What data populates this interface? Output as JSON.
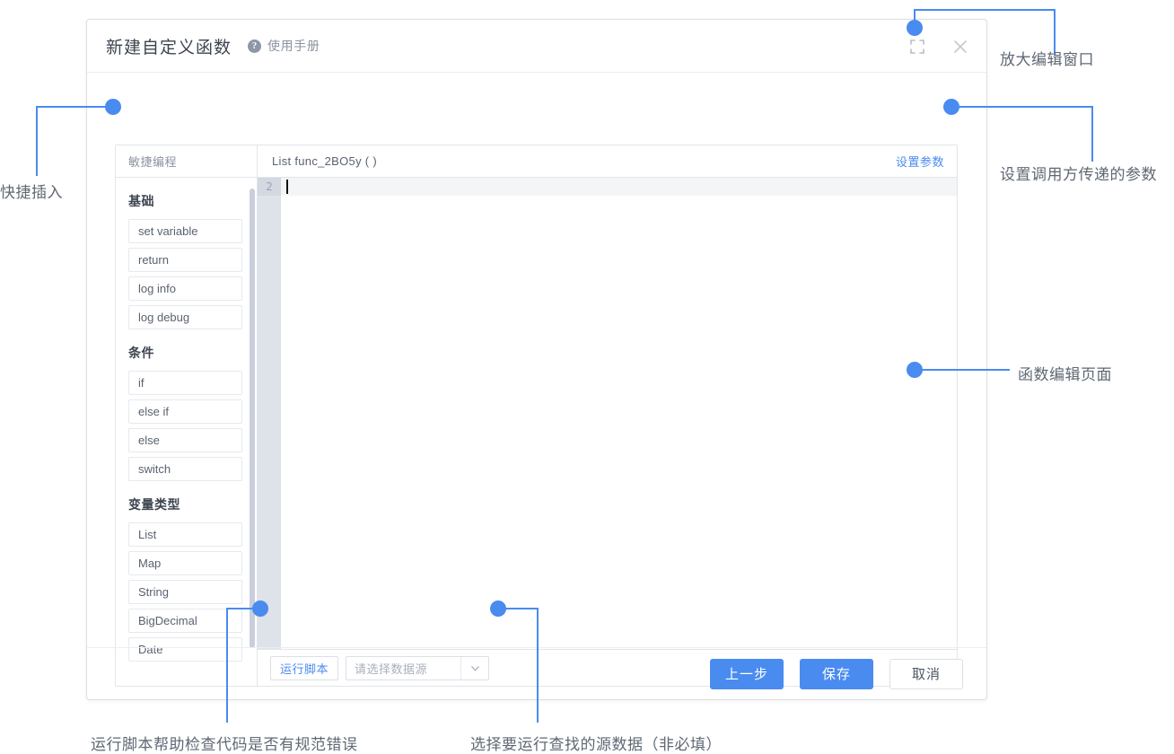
{
  "dialog": {
    "title": "新建自定义函数",
    "manual_label": "使用手册",
    "help_icon": "question-circle-icon",
    "expand_icon": "fullscreen-expand-icon",
    "close_icon": "close-icon"
  },
  "sidebar": {
    "header": "敏捷编程",
    "groups": [
      {
        "title": "基础",
        "items": [
          "set variable",
          "return",
          "log info",
          "log debug"
        ]
      },
      {
        "title": "条件",
        "items": [
          "if",
          "else if",
          "else",
          "switch"
        ]
      },
      {
        "title": "变量类型",
        "items": [
          "List",
          "Map",
          "String",
          "BigDecimal",
          "Date"
        ]
      }
    ]
  },
  "editor": {
    "signature": "List func_2BO5y ( )",
    "param_link": "设置参数",
    "line_number": "2",
    "code": ""
  },
  "runbar": {
    "run_label": "运行脚本",
    "datasource_placeholder": "请选择数据源",
    "datasource_value": "",
    "dropdown_icon": "chevron-down-icon",
    "collapse_icon": "chevron-up-icon"
  },
  "footer": {
    "prev_label": "上一步",
    "save_label": "保存",
    "cancel_label": "取消"
  },
  "annotations": {
    "quick_insert": "快捷插入",
    "expand_window": "放大编辑窗口",
    "set_params": "设置调用方传递的参数",
    "function_editor": "函数编辑页面",
    "run_script": "运行脚本帮助检查代码是否有规范错误",
    "datasource": "选择要运行查找的源数据（非必填）"
  },
  "colors": {
    "accent": "#4a8bf0",
    "annotation": "#4a8bf0",
    "text": "#5a6270",
    "border": "#dcdfe6",
    "gutter": "#dee2e9"
  }
}
